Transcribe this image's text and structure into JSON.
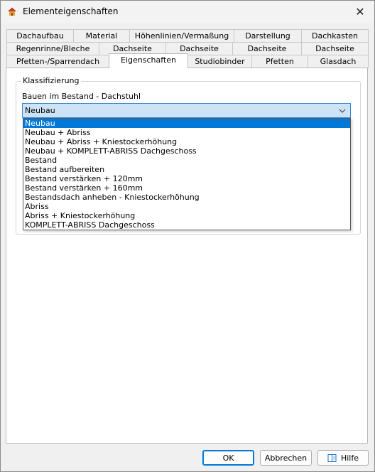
{
  "window": {
    "title": "Elementeigenschaften",
    "icon": "roof-house-icon",
    "close_glyph": "✕"
  },
  "tabs": {
    "row1": [
      "Dachaufbau",
      "Material",
      "Höhenlinien/Vermaßung",
      "Darstellung",
      "Dachkasten"
    ],
    "row2": [
      "Regenrinne/Bleche",
      "Dachseite",
      "Dachseite",
      "Dachseite",
      "Dachseite"
    ],
    "row3": [
      "Pfetten-/Sparrendach",
      "Eigenschaften",
      "Studiobinder",
      "Pfetten",
      "Glasdach"
    ],
    "active": "Eigenschaften"
  },
  "group": {
    "label": "Klassifizierung"
  },
  "field": {
    "label": "Bauen im Bestand - Dachstuhl",
    "value": "Neubau",
    "options": [
      "Neubau",
      "Neubau + Abriss",
      "Neubau + Abriss + Kniestockerhöhung",
      "Neubau + KOMPLETT-ABRISS Dachgeschoss",
      "Bestand",
      "Bestand aufbereiten",
      "Bestand verstärken + 120mm",
      "Bestand verstärken + 160mm",
      "Bestandsdach anheben - Kniestockerhöhung",
      "Abriss",
      "Abriss + Kniestockerhöhung",
      "KOMPLETT-ABRISS Dachgeschoss"
    ],
    "selected_index": 0
  },
  "buttons": {
    "ok": "OK",
    "cancel": "Abbrechen",
    "help": "Hilfe"
  },
  "colors": {
    "selection": "#0078d7",
    "focus_border": "#3b86d6",
    "combo_bg": "#cde4f7"
  }
}
